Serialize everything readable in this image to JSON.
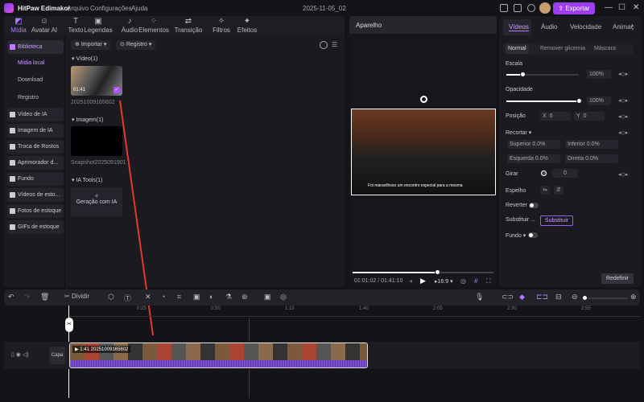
{
  "app": {
    "title": "HitPaw Edimakor",
    "menus": [
      "Arquivo",
      "Configurações",
      "Ajuda"
    ],
    "date": "2025-11-05_02",
    "export": "Exportar"
  },
  "tools": [
    {
      "label": "Mídia",
      "icon": "media-icon"
    },
    {
      "label": "Avatar AI",
      "icon": "avatar-icon"
    },
    {
      "label": "Texto",
      "icon": "text-icon"
    },
    {
      "label": "Legendas",
      "icon": "subtitles-icon"
    },
    {
      "label": "Áudio",
      "icon": "music-icon"
    },
    {
      "label": "Elementos",
      "icon": "elements-icon"
    },
    {
      "label": "Transição",
      "icon": "transition-icon"
    },
    {
      "label": "Filtros",
      "icon": "filter-icon"
    },
    {
      "label": "Efeitos",
      "icon": "effects-icon"
    }
  ],
  "sidebar": {
    "library": "Biblioteca",
    "sub": [
      "Mídia local",
      "Download",
      "Registro"
    ],
    "items": [
      "Vídeo de IA",
      "Imagem de IA",
      "Troca de Rostos",
      "Aprimorador d...",
      "Fundo",
      "Vídeos de esto...",
      "Fotos de estoque",
      "GIFs de estoque"
    ]
  },
  "media": {
    "import": "Importar",
    "record": "Registro",
    "video_section": "Vídeo(1)",
    "video_name": "20251009165602",
    "video_duration": "01:41",
    "image_section": "Imagem(1)",
    "image_name": "Snapshot2025091901",
    "ai_section": "IA Tools(1)",
    "ai_gen": "Geração com IA"
  },
  "preview": {
    "title": "Aparelho",
    "subtitle": "Foi maravilhoso um encontro especial para a mesma",
    "time_current": "01:01:02",
    "time_total": "01:41:10",
    "ratio": "16:9",
    "progress": 0.6
  },
  "props": {
    "tabs": [
      "Vídeos",
      "Áudio",
      "Velocidade",
      "Animaç"
    ],
    "subtabs": [
      "Normal",
      "Remover glicemia",
      "Máscara"
    ],
    "scale_label": "Escala",
    "scale": "100%",
    "scale_value": 100,
    "opacity_label": "Opacidade",
    "opacity": "100%",
    "opacity_value": 100,
    "position_label": "Posição",
    "x": "0",
    "y": "0",
    "crop_label": "Recortar",
    "top": "Superior 0.0%",
    "bottom": "Inferior  0.0%",
    "left": "Esquerda 0.0%",
    "right": "Direita  0.0%",
    "rotate_label": "Girar",
    "rotate": "0",
    "mirror_label": "Espelho",
    "reverse_label": "Reverter",
    "replace_label": "Substituir ...",
    "replace_btn": "Substituir",
    "bg_label": "Fundo",
    "reset": "Redefinir"
  },
  "timeline": {
    "split": "Dividir",
    "ruler": [
      "0:25",
      "0:50",
      "1:15",
      "1:40",
      "2:05",
      "2:30",
      "2:55"
    ],
    "cover": "Capa",
    "clip_duration": "1:41",
    "clip_name": "20251009165602"
  },
  "colors": {
    "accent": "#9b3ef0",
    "active": "#b07cff"
  }
}
